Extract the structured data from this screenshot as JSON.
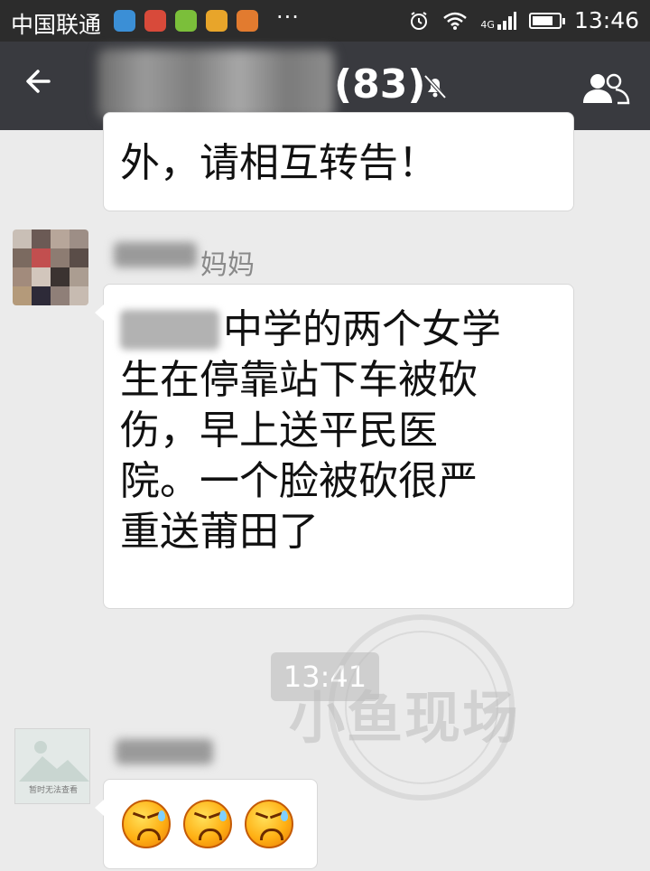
{
  "status_bar": {
    "carrier": "中国联通",
    "more": "···",
    "network": "4G",
    "time": "13:46",
    "app_icon_colors": [
      "#3b8fd6",
      "#d84a3a",
      "#7bbf3a",
      "#e8a52a",
      "#e27b2f"
    ]
  },
  "header": {
    "back_icon": "back-arrow-icon",
    "title_count": "(83)",
    "mute_icon": "muted-bell-icon",
    "group_icon": "group-members-icon"
  },
  "messages": [
    {
      "text": "外，请相互转告！"
    },
    {
      "sender_suffix": "妈妈",
      "text": "中学的两个女学\n生在停靠站下车被砍\n伤，早上送平民医\n院。一个脸被砍很严\n重送莆田了"
    },
    {
      "timestamp": "13:41"
    },
    {
      "broken_image_label": "暂时无法查看",
      "emoji_icon": "sweating-angry-face-icon",
      "emoji_count": 3
    }
  ],
  "watermark": {
    "text": "小鱼现场"
  },
  "colors": {
    "status_bg": "#2c2c2c",
    "header_bg": "#393a3f",
    "chat_bg": "#ebebeb",
    "bubble_bg": "#ffffff"
  }
}
